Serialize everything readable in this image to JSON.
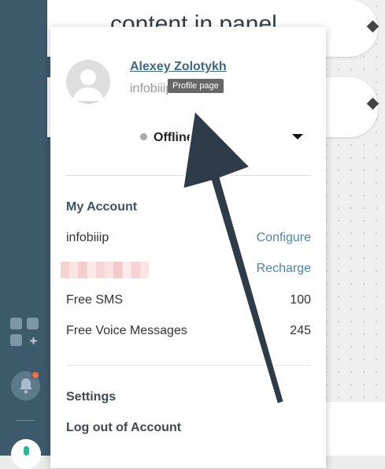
{
  "canvas": {
    "node_title": "content in panel"
  },
  "profile": {
    "name": "Alexey Zolotykh",
    "login": "infobiiip",
    "tooltip": "Profile page",
    "status": "Offline"
  },
  "account": {
    "title": "My Account",
    "rows": [
      {
        "label": "infobiiip",
        "action": "Configure"
      },
      {
        "label": "",
        "action": "Recharge"
      },
      {
        "label": "Free SMS",
        "value": "100"
      },
      {
        "label": "Free Voice Messages",
        "value": "245"
      }
    ]
  },
  "menu": {
    "settings": "Settings",
    "logout": "Log out of Account"
  },
  "colors": {
    "rail": "#3d5a6c",
    "accent_link": "#4a86b4",
    "notification_dot": "#f07146",
    "arrow": "#2e3b48"
  }
}
